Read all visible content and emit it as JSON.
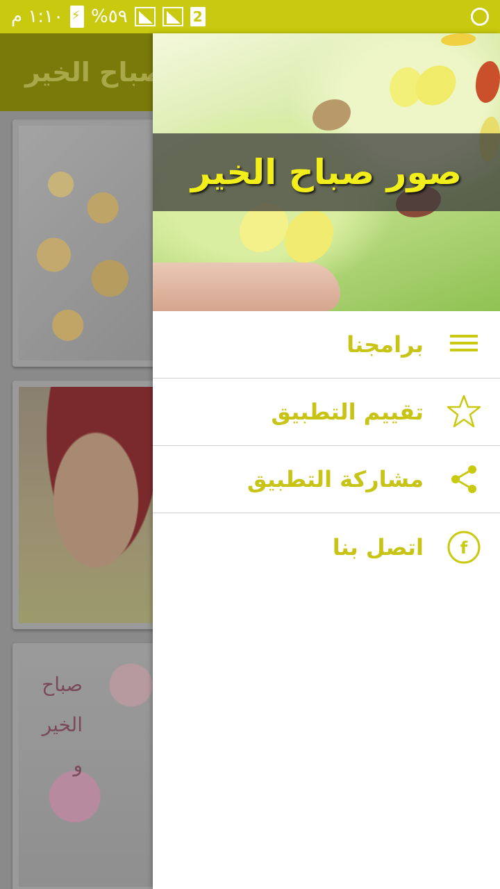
{
  "status_bar": {
    "time": "١:١٠ م",
    "battery": "%٥٩",
    "sim": "2"
  },
  "app": {
    "title": "صباح الخير"
  },
  "cards": [
    {
      "caption": ""
    },
    {
      "caption": ""
    },
    {
      "caption_lines": [
        "صباح",
        "الخير",
        "و"
      ]
    }
  ],
  "drawer": {
    "header_title": "صور صباح الخير",
    "items": [
      {
        "label": "برامجنا",
        "icon": "menu-icon"
      },
      {
        "label": "تقييم التطبيق",
        "icon": "star-icon"
      },
      {
        "label": "مشاركة التطبيق",
        "icon": "share-icon"
      },
      {
        "label": "اتصل بنا",
        "icon": "facebook-icon"
      }
    ]
  },
  "colors": {
    "accent": "#c9c90f",
    "menu_text": "#c7c416"
  }
}
